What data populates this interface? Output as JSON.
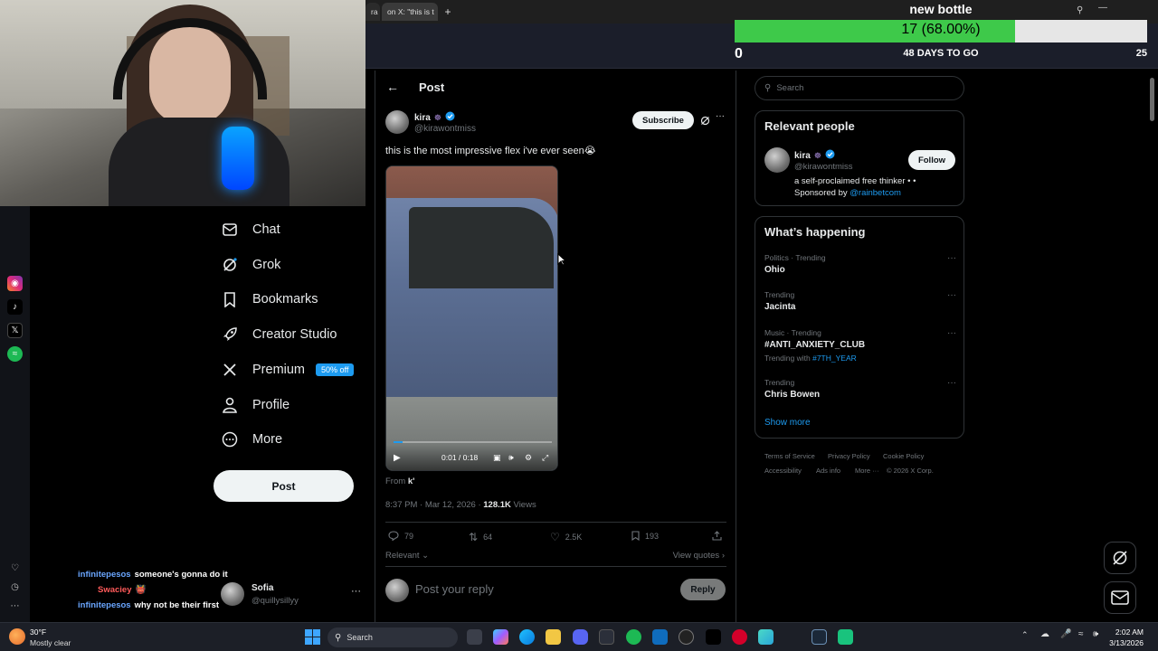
{
  "browser": {
    "tabs": [
      {
        "label": "ra"
      },
      {
        "label": "on X: \"this is t"
      }
    ]
  },
  "goal": {
    "title": "new bottle",
    "progress_text": "17 (68.00%)",
    "progress_fraction": 0.68,
    "min": "0",
    "days_text": "48 DAYS TO GO",
    "max": "25",
    "fill_color": "#3ec94a"
  },
  "nav": {
    "items": [
      {
        "label": "Chat",
        "icon": "chat-icon"
      },
      {
        "label": "Grok",
        "icon": "grok-icon"
      },
      {
        "label": "Bookmarks",
        "icon": "bookmark-icon"
      },
      {
        "label": "Creator Studio",
        "icon": "rocket-icon"
      },
      {
        "label": "Premium",
        "icon": "x-logo-icon"
      },
      {
        "label": "Profile",
        "icon": "person-icon"
      },
      {
        "label": "More",
        "icon": "more-circle-icon"
      }
    ],
    "premium_badge": "50% off",
    "post_button": "Post"
  },
  "account": {
    "name": "Sofia",
    "handle": "@quillysillyy"
  },
  "chat_overlay": [
    {
      "user": "infinitepesos",
      "message": "someone's gonna do it",
      "user_color": "#6aa6ff"
    },
    {
      "user": "Swaciey",
      "message": "👹",
      "user_color": "#ff5a5a"
    },
    {
      "user": "infinitepesos",
      "message": "why not be their first",
      "user_color": "#6aa6ff"
    }
  ],
  "post": {
    "header_title": "Post",
    "author_name": "kira",
    "author_handle": "@kirawontmiss",
    "subscribe_label": "Subscribe",
    "text": "this is the most impressive flex i've ever seen😭",
    "video_time": "0:01 / 0:18",
    "video_progress_fraction": 0.056,
    "from_label": "From",
    "from_value": "k'",
    "timestamp": "8:37 PM · Mar 12, 2026 ·",
    "views_count": "128.1K",
    "views_label": "Views",
    "stats": {
      "replies": "79",
      "reposts": "64",
      "likes": "2.5K",
      "bookmarks": "193"
    },
    "relevant_label": "Relevant",
    "view_quotes_label": "View quotes",
    "reply_placeholder": "Post your reply",
    "reply_button": "Reply"
  },
  "sidebar": {
    "search_placeholder": "Search",
    "relevant_people": {
      "title": "Relevant people",
      "name": "kira",
      "handle": "@kirawontmiss",
      "follow_label": "Follow",
      "bio_line1": "a self-proclaimed free thinker • •",
      "bio_line2_prefix": "Sponsored by",
      "bio_line2_link": "@rainbetcom"
    },
    "whats_happening": {
      "title": "What’s happening",
      "trends": [
        {
          "meta": "Politics · Trending",
          "name": "Ohio",
          "extra": ""
        },
        {
          "meta": "Trending",
          "name": "Jacinta",
          "extra": ""
        },
        {
          "meta": "Music · Trending",
          "name": "#ANTI_ANXIETY_CLUB",
          "extra_prefix": "Trending with",
          "extra": "#7TH_YEAR"
        },
        {
          "meta": "Trending",
          "name": "Chris Bowen",
          "extra": ""
        }
      ],
      "show_more": "Show more"
    },
    "footer": {
      "terms": "Terms of Service",
      "privacy": "Privacy Policy",
      "cookie": "Cookie Policy",
      "accessibility": "Accessibility",
      "ads": "Ads info",
      "more": "More ···",
      "copyright": "© 2026 X Corp."
    }
  },
  "taskbar": {
    "weather_temp": "30°F",
    "weather_desc": "Mostly clear",
    "search_label": "Search",
    "time": "2:02 AM",
    "date": "3/13/2026"
  }
}
